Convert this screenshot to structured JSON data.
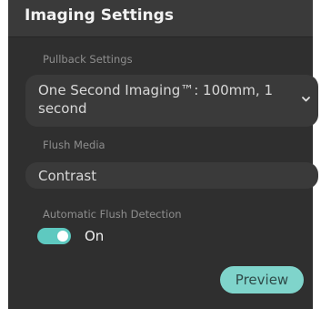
{
  "panel": {
    "title": "Imaging Settings"
  },
  "pullback": {
    "label": "Pullback Settings",
    "selected": "One Second Imaging™: 100mm, 1 second",
    "icon": "chevron-down-icon"
  },
  "flush_media": {
    "label": "Flush Media",
    "value": "Contrast"
  },
  "auto_flush": {
    "label": "Automatic Flush Detection",
    "toggle_state": "On",
    "enabled": true
  },
  "actions": {
    "preview_label": "Preview"
  },
  "colors": {
    "panel_bg": "#2f2f2f",
    "header_bg": "#3a3a3a",
    "field_bg": "#3a3a3a",
    "accent": "#5ec9c0",
    "button_bg": "#7fd4cb"
  }
}
